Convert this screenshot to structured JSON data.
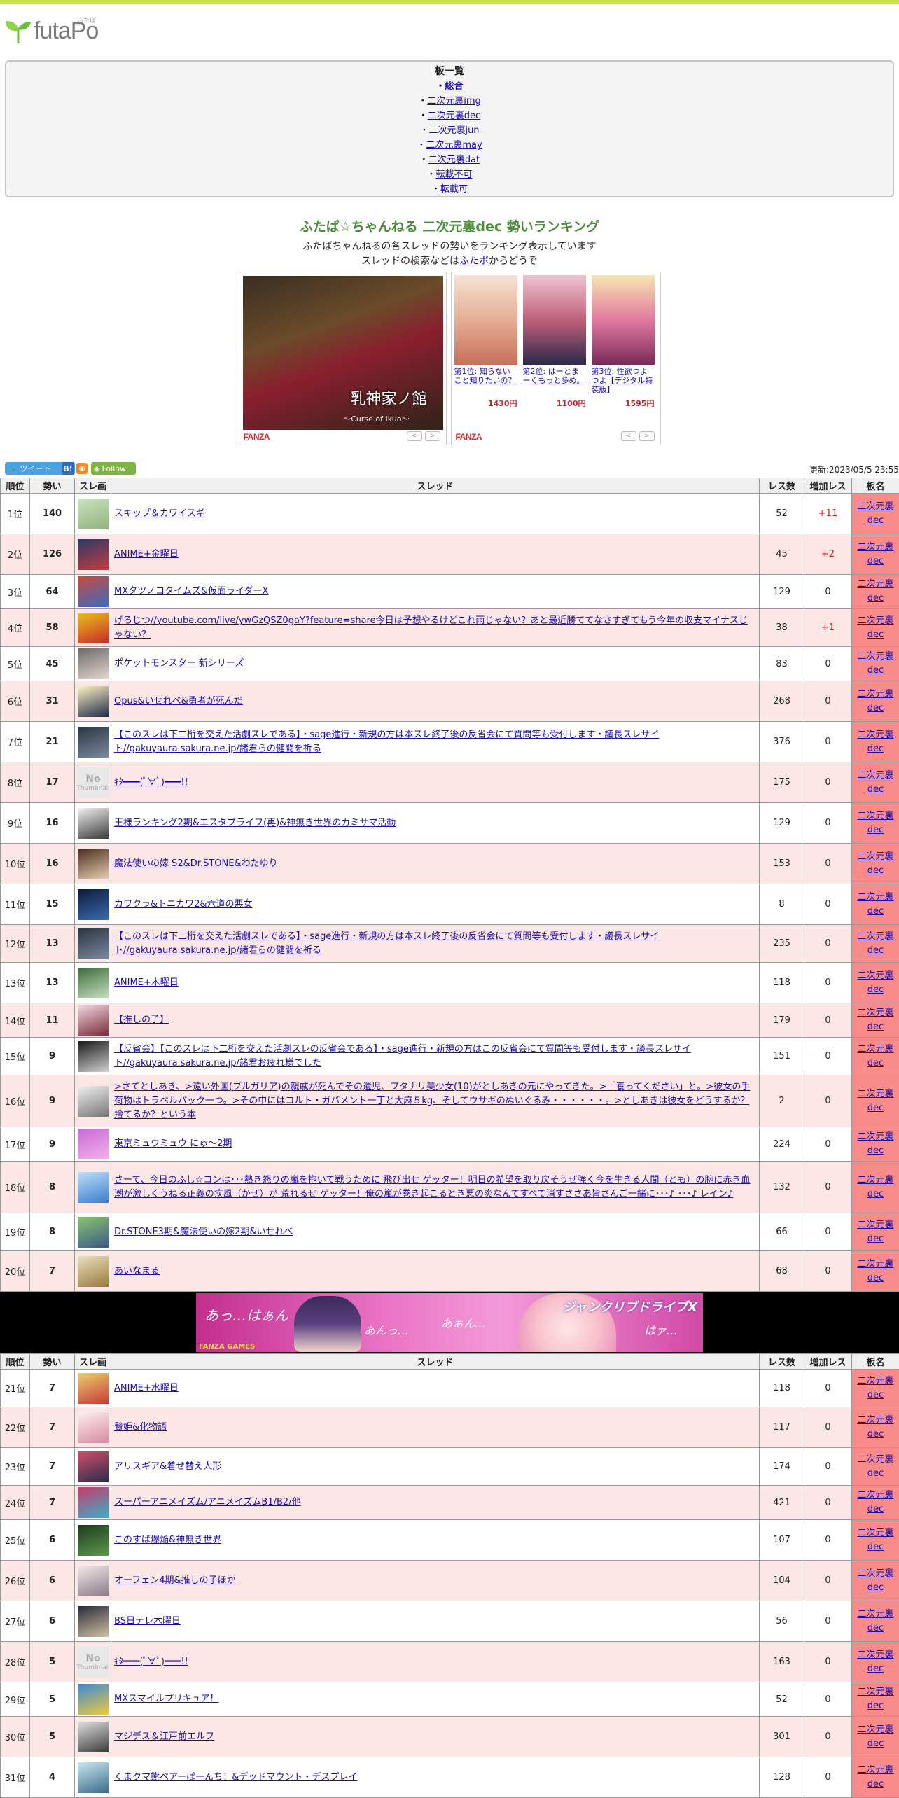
{
  "logo": {
    "text": "futaPo",
    "ruby": "ふたぽ"
  },
  "boards": {
    "title": "板一覧",
    "items": [
      {
        "label": "総合",
        "current": true
      },
      {
        "label": "二次元裏img"
      },
      {
        "label": "二次元裏dec"
      },
      {
        "label": "二次元裏jun"
      },
      {
        "label": "二次元裏may"
      },
      {
        "label": "二次元裏dat"
      },
      {
        "label": "転載不可"
      },
      {
        "label": "転載可"
      }
    ]
  },
  "ranking": {
    "title": "ふたば☆ちゃんねる 二次元裏dec 勢いランキング",
    "desc1": "ふたばちゃんねるの各スレッドの勢いをランキング表示しています",
    "desc2_pre": "スレッドの検索などは",
    "desc2_link": "ふたポ",
    "desc2_post": "からどうぞ"
  },
  "ads": {
    "ad1_caption": "乳神家ノ館",
    "ad1_sub": "〜Curse of Ikuo〜",
    "fanza": "FANZA",
    "items": [
      {
        "title": "第1位: 知らないこと知りたいの？",
        "price": "1430円"
      },
      {
        "title": "第2位: はーとまーくもっと多め。",
        "price": "1100円"
      },
      {
        "title": "第3位: 性欲つよつよ【デジタル特装版】",
        "price": "1595円"
      }
    ],
    "nav_prev": "<",
    "nav_next": ">"
  },
  "toolbar": {
    "tweet": "ツイート",
    "hatena": "B!",
    "follow": "Follow",
    "updated": "更新:2023/05/5 23:55"
  },
  "table_headers": [
    "順位",
    "勢い",
    "スレ画",
    "スレッド",
    "レス数",
    "増加レス",
    "板名"
  ],
  "board_name": "二次元裏dec",
  "rows1": [
    {
      "rank": "1位",
      "ikioi": "140",
      "title": "スキップ＆カワイスギ",
      "res": "52",
      "inc": "+11",
      "thumb": [
        "#c9e2c0",
        "#8fb47a"
      ]
    },
    {
      "rank": "2位",
      "ikioi": "126",
      "title": "ANIME+金曜日",
      "res": "45",
      "inc": "+2",
      "thumb": [
        "#2b3a6b",
        "#c73b3b"
      ]
    },
    {
      "rank": "3位",
      "ikioi": "64",
      "title": "MXタツノコタイムズ&仮面ライダーX",
      "res": "129",
      "inc": "0",
      "thumb": [
        "#c64b3a",
        "#3b6bc6"
      ]
    },
    {
      "rank": "4位",
      "ikioi": "58",
      "title": "げろじつ//youtube.com/live/ywGzQSZ0gaY?feature=share今日は予想やるけどこれ雨じゃない？あと最近勝ててなさすぎてもう今年の収支マイナスじゃない？",
      "res": "38",
      "inc": "+1",
      "thumb": [
        "#e9c21a",
        "#c82a2a"
      ]
    },
    {
      "rank": "5位",
      "ikioi": "45",
      "title": "ポケットモンスター 新シリーズ",
      "res": "83",
      "inc": "0",
      "thumb": [
        "#6b6b6b",
        "#e6d6cc"
      ]
    },
    {
      "rank": "6位",
      "ikioi": "31",
      "title": "Opus&いせれべ&勇者が死んだ",
      "res": "268",
      "inc": "0",
      "thumb": [
        "#fff3c4",
        "#1f2b4a"
      ]
    },
    {
      "rank": "7位",
      "ikioi": "21",
      "title": "【このスレは下二桁を交えた活劇スレである】・sage進行・新規の方は本スレ終了後の反省会にて質問等も受付します・議長スレサイト//gakuyaura.sakura.ne.jp/諸君らの健闘を祈る",
      "res": "376",
      "inc": "0",
      "thumb": [
        "#2a3442",
        "#7b8aa0"
      ]
    },
    {
      "rank": "8位",
      "ikioi": "17",
      "title": "ｷﾀ━━━(ﾟ∀ﾟ)━━━!!",
      "res": "175",
      "inc": "0",
      "thumb": "none"
    },
    {
      "rank": "9位",
      "ikioi": "16",
      "title": "王様ランキング2期&エスタブライフ(再)&神無き世界のカミサマ活動",
      "res": "129",
      "inc": "0",
      "thumb": [
        "#f2f2f2",
        "#3a3a3a"
      ]
    },
    {
      "rank": "10位",
      "ikioi": "16",
      "title": "魔法使いの嫁 S2&Dr.STONE&わたゆり",
      "res": "153",
      "inc": "0",
      "thumb": [
        "#4a2b1e",
        "#e7d0b0"
      ]
    },
    {
      "rank": "11位",
      "ikioi": "15",
      "title": "カワクラ&トニカワ2&六道の悪女",
      "res": "8",
      "inc": "0",
      "thumb": [
        "#0d1b3a",
        "#3a6bb0"
      ]
    },
    {
      "rank": "12位",
      "ikioi": "13",
      "title": "【このスレは下二桁を交えた活劇スレである】・sage進行・新規の方は本スレ終了後の反省会にて質問等も受付します・議長スレサイト//gakuyaura.sakura.ne.jp/諸君らの健闘を祈る",
      "res": "235",
      "inc": "0",
      "thumb": [
        "#2a3442",
        "#7b8aa0"
      ]
    },
    {
      "rank": "13位",
      "ikioi": "13",
      "title": "ANIME+木曜日",
      "res": "118",
      "inc": "0",
      "thumb": [
        "#3a6b3a",
        "#c8e0c0"
      ]
    },
    {
      "rank": "14位",
      "ikioi": "11",
      "title": "【推しの子】",
      "res": "179",
      "inc": "0",
      "thumb": [
        "#f3d9e0",
        "#7a2b3a"
      ]
    },
    {
      "rank": "15位",
      "ikioi": "9",
      "title": "【反省会】【このスレは下二桁を交えた活劇スレの反省会である】・sage進行・新規の方はこの反省会にて質問等も受付します・議長スレサイト//gakuyaura.sakura.ne.jp/諸君お疲れ様でした",
      "res": "151",
      "inc": "0",
      "thumb": [
        "#1a1a1a",
        "#d0d0d0"
      ]
    },
    {
      "rank": "16位",
      "ikioi": "9",
      "title": ">さてとしあき、>遠い外国(ブルガリア)の親戚が死んでその遺児、フタナリ美少女(10)がとしあきの元にやってきた。>「養ってください」と。>彼女の手荷物はトラベルパック一つ。>その中にはコルト・ガバメント一丁と大麻５kg、そしてウサギのぬいぐるみ・・・・・・。>としあきは彼女をどうするか？捨てるか？という本",
      "res": "2",
      "inc": "0",
      "thumb": [
        "#f0f0f0",
        "#777777"
      ]
    },
    {
      "rank": "17位",
      "ikioi": "9",
      "title": "東京ミュウミュウ にゅ～2期",
      "res": "224",
      "inc": "0",
      "thumb": [
        "#c86bd8",
        "#f3b0e8"
      ]
    },
    {
      "rank": "18位",
      "ikioi": "8",
      "title": "さーて、今日のふし☆コンは･･･熱き怒りの嵐を抱いて戦うために 飛び出せ ゲッター！明日の希望を取り戻そうぜ強く今を生きる人間（とも）の腕に赤き血潮が激しくうねる正義の疾風（かぜ）が 荒れるぜ ゲッター！俺の嵐が巻き起こるとき悪の炎なんてすべて消すささあ皆さんご一緒に･･･♪ ･･･♪ レイン♪",
      "res": "132",
      "inc": "0",
      "thumb": [
        "#bfe0f7",
        "#3a7bd0"
      ]
    },
    {
      "rank": "19位",
      "ikioi": "8",
      "title": "Dr.STONE3期&魔法使いの嫁2期&いせれべ",
      "res": "66",
      "inc": "0",
      "thumb": [
        "#8bc36b",
        "#3a5a8a"
      ]
    },
    {
      "rank": "20位",
      "ikioi": "7",
      "title": "あいなまる",
      "res": "68",
      "inc": "0",
      "thumb": [
        "#e8e0c0",
        "#9a7a3a"
      ]
    }
  ],
  "banner": {
    "text1": "あっ…はぁん",
    "text2": "あんっ…",
    "text3": "あぁん…",
    "text4": "はァ…",
    "logo": "ジャンクリブドライブX",
    "fanza_games": "FANZA GAMES"
  },
  "rows2": [
    {
      "rank": "21位",
      "ikioi": "7",
      "title": "ANIME+水曜日",
      "res": "118",
      "inc": "0",
      "thumb": [
        "#e8d06b",
        "#c83a3a"
      ]
    },
    {
      "rank": "22位",
      "ikioi": "7",
      "title": "贄姫&化物語",
      "res": "117",
      "inc": "0",
      "thumb": [
        "#fbeef2",
        "#d9899f"
      ]
    },
    {
      "rank": "23位",
      "ikioi": "7",
      "title": "アリスギア&着せ替え人形",
      "res": "174",
      "inc": "0",
      "thumb": [
        "#d0506b",
        "#2b2b4a"
      ]
    },
    {
      "rank": "24位",
      "ikioi": "7",
      "title": "スーパーアニメイズム/アニメイズムB1/B2/他",
      "res": "421",
      "inc": "0",
      "thumb": [
        "#c83a6b",
        "#3ab0c8"
      ]
    },
    {
      "rank": "25位",
      "ikioi": "6",
      "title": "このすば爆焔&神無き世界",
      "res": "107",
      "inc": "0",
      "thumb": [
        "#1e3a1e",
        "#5a9a4a"
      ]
    },
    {
      "rank": "26位",
      "ikioi": "6",
      "title": "オーフェン4期&推しの子ほか",
      "res": "104",
      "inc": "0",
      "thumb": [
        "#f2eaea",
        "#8a7a8a"
      ]
    },
    {
      "rank": "27位",
      "ikioi": "6",
      "title": "BS日テレ木曜日",
      "res": "56",
      "inc": "0",
      "thumb": [
        "#2a2a3a",
        "#d0c0a0"
      ]
    },
    {
      "rank": "28位",
      "ikioi": "5",
      "title": "ｷﾀ━━━(ﾟ∀ﾟ)━━━!!",
      "res": "163",
      "inc": "0",
      "thumb": "none"
    },
    {
      "rank": "29位",
      "ikioi": "5",
      "title": "MXスマイルプリキュア！",
      "res": "52",
      "inc": "0",
      "thumb": [
        "#3a8ad8",
        "#f0c83a"
      ]
    },
    {
      "rank": "30位",
      "ikioi": "5",
      "title": "マジデス＆江戸前エルフ",
      "res": "301",
      "inc": "0",
      "thumb": [
        "#e0e0e0",
        "#3a3a3a"
      ]
    },
    {
      "rank": "31位",
      "ikioi": "4",
      "title": "くまクマ熊ベアーぱーんち！&デッドマウント・デスプレイ",
      "res": "128",
      "inc": "0",
      "thumb": [
        "#c8e8f0",
        "#3a6b8a"
      ]
    }
  ]
}
